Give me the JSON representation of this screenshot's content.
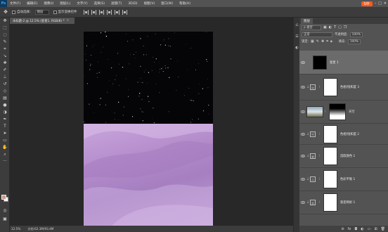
{
  "app": {
    "logo": "Ps"
  },
  "menubar": {
    "items": [
      "文件(F)",
      "编辑(E)",
      "图像(I)",
      "图层(L)",
      "文字(Y)",
      "选择(S)",
      "滤镜(T)",
      "3D(D)",
      "视图(V)",
      "窗口(W)",
      "帮助(H)"
    ],
    "sogou_label": "S中"
  },
  "options_bar": {
    "auto_select_label": "自动选择：",
    "auto_select_value": "图层",
    "show_transform_label": "显示变换控件"
  },
  "document": {
    "tab_title": "未标题-2 @ 12.5% (星星1, RGB/8) *",
    "close_glyph": "×",
    "zoom": "12.5%",
    "doc_info": "文档:62.3M/93.4M"
  },
  "layers_panel": {
    "tab": "图层",
    "filter_label": "ρ 类型",
    "blend_mode": "正常",
    "opacity_label": "不透明度:",
    "opacity_value": "100%",
    "lock_label": "锁定:",
    "fill_label": "填充:",
    "fill_value": "100%",
    "layers": [
      {
        "name": "星星 1",
        "kind": "pixel",
        "visible": true,
        "selected": true
      },
      {
        "name": "色相/饱和度 3",
        "kind": "adjustment",
        "visible": true,
        "clipped": true
      },
      {
        "name": "天空",
        "kind": "photo",
        "visible": true
      },
      {
        "name": "色相/饱和度 2",
        "kind": "adjustment",
        "visible": true,
        "clipped": true
      },
      {
        "name": "选取颜色 1",
        "kind": "adjustment",
        "visible": true,
        "clipped": true
      },
      {
        "name": "色彩平衡 1",
        "kind": "adjustment",
        "visible": true,
        "clipped": true
      },
      {
        "name": "渐变映射 1",
        "kind": "adjustment",
        "visible": true,
        "clipped": true
      }
    ]
  },
  "colors": {
    "foreground": "#c79b8a",
    "background": "#ffffff",
    "selected_layer": "#6b6b6b"
  }
}
